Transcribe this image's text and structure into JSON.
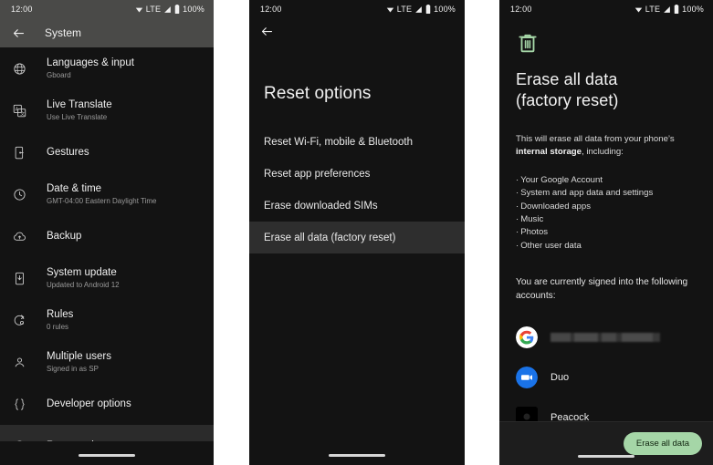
{
  "status_bar": {
    "time": "12:00",
    "network_label": "LTE",
    "battery_pct": "100%",
    "icons": [
      "wifi-icon",
      "signal-icon",
      "battery-icon"
    ]
  },
  "colors": {
    "background": "#131313",
    "app_bar": "#4a4a48",
    "selected_row": "#2b2b2b",
    "accent_green": "#a5d6a7",
    "trash_green": "#a5d6a7",
    "secondary_text": "#9a9a9a"
  },
  "panel_system": {
    "app_bar": {
      "back_label": "Back",
      "title": "System"
    },
    "items": [
      {
        "icon": "globe-icon",
        "label": "Languages & input",
        "sub": "Gboard",
        "selected": false
      },
      {
        "icon": "translate-icon",
        "label": "Live Translate",
        "sub": "Use Live Translate",
        "selected": false
      },
      {
        "icon": "gestures-icon",
        "label": "Gestures",
        "sub": "",
        "selected": false
      },
      {
        "icon": "clock-icon",
        "label": "Date & time",
        "sub": "GMT-04:00 Eastern Daylight Time",
        "selected": false
      },
      {
        "icon": "cloud-upload-icon",
        "label": "Backup",
        "sub": "",
        "selected": false
      },
      {
        "icon": "system-update-icon",
        "label": "System update",
        "sub": "Updated to Android 12",
        "selected": false
      },
      {
        "icon": "rules-icon",
        "label": "Rules",
        "sub": "0 rules",
        "selected": false
      },
      {
        "icon": "person-icon",
        "label": "Multiple users",
        "sub": "Signed in as SP",
        "selected": false
      },
      {
        "icon": "braces-icon",
        "label": "Developer options",
        "sub": "",
        "selected": false
      },
      {
        "icon": "history-icon",
        "label": "Reset options",
        "sub": "",
        "selected": true
      }
    ]
  },
  "panel_reset": {
    "back_label": "Back",
    "title": "Reset options",
    "options": [
      {
        "label": "Reset Wi-Fi, mobile & Bluetooth",
        "selected": false
      },
      {
        "label": "Reset app preferences",
        "selected": false
      },
      {
        "label": "Erase downloaded SIMs",
        "selected": false
      },
      {
        "label": "Erase all data (factory reset)",
        "selected": true
      }
    ]
  },
  "panel_erase": {
    "icon": "trash-icon",
    "title_line1": "Erase all data",
    "title_line2": "(factory reset)",
    "description_prefix": "This will erase all data from your phone’s ",
    "description_bold": "internal storage",
    "description_suffix": ", including:",
    "bullets": [
      "Your Google Account",
      "System and app data and settings",
      "Downloaded apps",
      "Music",
      "Photos",
      "Other user data"
    ],
    "accounts_intro": "You are currently signed into the following accounts:",
    "accounts": [
      {
        "icon": "google-icon",
        "name": "",
        "redacted": true
      },
      {
        "icon": "duo-icon",
        "name": "Duo",
        "redacted": false
      },
      {
        "icon": "peacock-icon",
        "name": "Peacock",
        "redacted": false
      }
    ],
    "primary_button": "Erase all data"
  }
}
